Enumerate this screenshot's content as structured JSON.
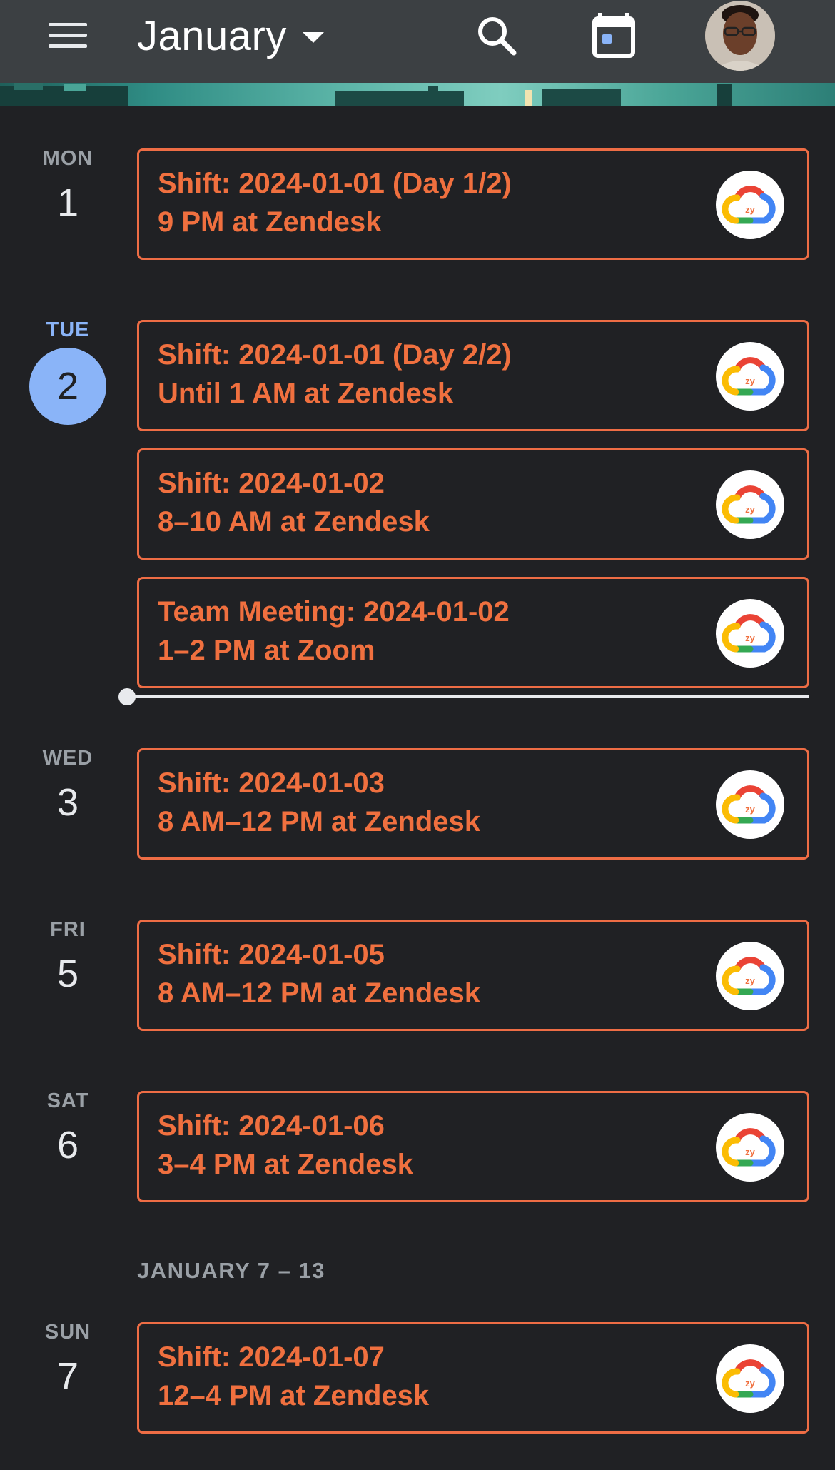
{
  "header": {
    "month": "January",
    "icons": {
      "menu": "hamburger-menu-icon",
      "dropdown": "caret-down-icon",
      "search": "search-icon",
      "today": "calendar-today-icon",
      "avatar": "user-avatar"
    }
  },
  "colors": {
    "event_accent": "#f0703f",
    "today_accent": "#8ab4f8",
    "background": "#202124",
    "topbar": "#3c4043"
  },
  "days": [
    {
      "dow": "MON",
      "num": "1"
    },
    {
      "dow": "TUE",
      "num": "2",
      "today": true
    },
    {
      "dow": "WED",
      "num": "3"
    },
    {
      "dow": "FRI",
      "num": "5"
    },
    {
      "dow": "SAT",
      "num": "6"
    },
    {
      "dow": "SUN",
      "num": "7"
    }
  ],
  "week_header": "JANUARY 7 – 13",
  "events": [
    {
      "title": "Shift: 2024-01-01 (Day 1/2)",
      "subtitle": "9 PM at Zendesk"
    },
    {
      "title": "Shift: 2024-01-01 (Day 2/2)",
      "subtitle": "Until 1 AM at Zendesk"
    },
    {
      "title": "Shift: 2024-01-02",
      "subtitle": "8–10 AM at Zendesk"
    },
    {
      "title": "Team Meeting: 2024-01-02",
      "subtitle": "1–2 PM at Zoom"
    },
    {
      "title": "Shift: 2024-01-03",
      "subtitle": "8 AM–12 PM at Zendesk"
    },
    {
      "title": "Shift: 2024-01-05",
      "subtitle": "8 AM–12 PM at Zendesk"
    },
    {
      "title": "Shift: 2024-01-06",
      "subtitle": "3–4 PM at Zendesk"
    },
    {
      "title": "Shift: 2024-01-07",
      "subtitle": "12–4 PM at Zendesk"
    }
  ],
  "event_logo": {
    "icon": "google-cloud-zy-logo-icon",
    "text": "zy"
  }
}
